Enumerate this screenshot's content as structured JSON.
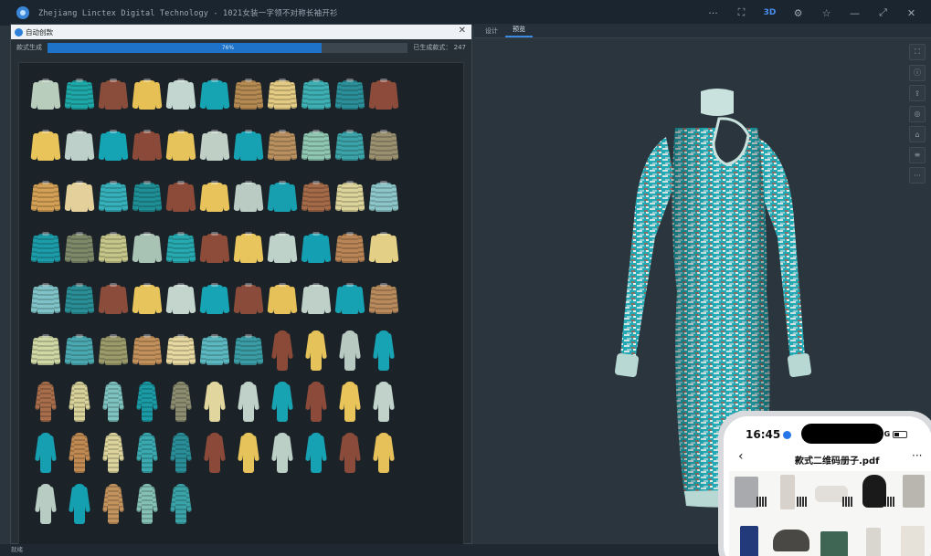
{
  "window": {
    "title": "Zhejiang Linctex Digital Technology - 1021女装一字领不对称长袖开衫",
    "toolbar_3d_label": "3D",
    "controls": [
      "···",
      "⛶",
      "3D",
      "⚙",
      "☆",
      "—",
      "⤢",
      "✕"
    ]
  },
  "dialog": {
    "title": "自动创款",
    "close_label": "✕",
    "progress_label": "款式生成",
    "progress_percent": 76,
    "progress_text": "76%",
    "generated_label": "已生成款式： 247"
  },
  "colors": {
    "accent": "#1e73c8",
    "teal": "#19a9b8",
    "yellow": "#e7c15a",
    "rust": "#8a4a3a",
    "mint": "#b7d8c8"
  },
  "gallery": {
    "items": [
      {
        "type": "sweater",
        "color": "#b9cdbd",
        "stripe": false
      },
      {
        "type": "sweater",
        "color": "#1ea7a7",
        "stripe": true
      },
      {
        "type": "sweater",
        "color": "#8a4d3c",
        "stripe": false
      },
      {
        "type": "sweater",
        "color": "#e6bf55",
        "stripe": false
      },
      {
        "type": "sweater",
        "color": "#c3d6cf",
        "stripe": false
      },
      {
        "type": "sweater",
        "color": "#16a3b2",
        "stripe": false
      },
      {
        "type": "sweater",
        "color": "#b58a52",
        "stripe": true
      },
      {
        "type": "sweater",
        "color": "#e3cb83",
        "stripe": true
      },
      {
        "type": "sweater",
        "color": "#3eb0b4",
        "stripe": true
      },
      {
        "type": "sweater",
        "color": "#2b8f99",
        "stripe": true
      },
      {
        "type": "sweater",
        "color": "#8c4b3b",
        "stripe": false
      },
      {
        "type": "sweater",
        "color": "#e9c45a",
        "stripe": false
      },
      {
        "type": "sweater",
        "color": "#bdd0c9",
        "stripe": false
      },
      {
        "type": "sweater",
        "color": "#15a4b4",
        "stripe": false
      },
      {
        "type": "sweater",
        "color": "#8b4a39",
        "stripe": false
      },
      {
        "type": "sweater",
        "color": "#e7c35b",
        "stripe": false
      },
      {
        "type": "sweater",
        "color": "#c0cfc6",
        "stripe": false
      },
      {
        "type": "sweater",
        "color": "#17a2b3",
        "stripe": false
      },
      {
        "type": "sweater",
        "color": "#b88f5e",
        "stripe": true
      },
      {
        "type": "sweater",
        "color": "#8fc7b2",
        "stripe": true
      },
      {
        "type": "sweater",
        "color": "#3aa4a8",
        "stripe": true
      },
      {
        "type": "sweater",
        "color": "#9a9070",
        "stripe": true
      },
      {
        "type": "sweater",
        "color": "#d4a055",
        "stripe": true
      },
      {
        "type": "sweater",
        "color": "#e3d09a",
        "stripe": false
      },
      {
        "type": "sweater",
        "color": "#36b0ba",
        "stripe": true
      },
      {
        "type": "sweater",
        "color": "#1f8f96",
        "stripe": true
      },
      {
        "type": "sweater",
        "color": "#8c4a38",
        "stripe": false
      },
      {
        "type": "sweater",
        "color": "#e8c35c",
        "stripe": false
      },
      {
        "type": "sweater",
        "color": "#b9cbc3",
        "stripe": false
      },
      {
        "type": "sweater",
        "color": "#179fb0",
        "stripe": false
      },
      {
        "type": "sweater",
        "color": "#a56a48",
        "stripe": true
      },
      {
        "type": "sweater",
        "color": "#dcd49a",
        "stripe": true
      },
      {
        "type": "sweater",
        "color": "#8cc6c8",
        "stripe": true
      },
      {
        "type": "sweater",
        "color": "#1c9ca8",
        "stripe": true
      },
      {
        "type": "sweater",
        "color": "#7c8a6a",
        "stripe": true
      },
      {
        "type": "sweater",
        "color": "#c7c68a",
        "stripe": true
      },
      {
        "type": "sweater",
        "color": "#a8c2b4",
        "stripe": false
      },
      {
        "type": "sweater",
        "color": "#27a9b0",
        "stripe": true
      },
      {
        "type": "sweater",
        "color": "#8d4c3a",
        "stripe": false
      },
      {
        "type": "sweater",
        "color": "#e9c55d",
        "stripe": false
      },
      {
        "type": "sweater",
        "color": "#bfd2ca",
        "stripe": false
      },
      {
        "type": "sweater",
        "color": "#14a0b2",
        "stripe": false
      },
      {
        "type": "sweater",
        "color": "#b98556",
        "stripe": true
      },
      {
        "type": "sweater",
        "color": "#e4cf86",
        "stripe": false
      },
      {
        "type": "sweater",
        "color": "#7fc3c8",
        "stripe": true
      },
      {
        "type": "sweater",
        "color": "#2a8e96",
        "stripe": true
      },
      {
        "type": "sweater",
        "color": "#8b4c3b",
        "stripe": false
      },
      {
        "type": "sweater",
        "color": "#e8c45c",
        "stripe": false
      },
      {
        "type": "sweater",
        "color": "#c3d5cd",
        "stripe": false
      },
      {
        "type": "sweater",
        "color": "#17a4b4",
        "stripe": false
      },
      {
        "type": "sweater",
        "color": "#8a4b3a",
        "stripe": false
      },
      {
        "type": "sweater",
        "color": "#e6c15a",
        "stripe": false
      },
      {
        "type": "sweater",
        "color": "#bed0c7",
        "stripe": false
      },
      {
        "type": "sweater",
        "color": "#16a2b3",
        "stripe": false
      },
      {
        "type": "sweater",
        "color": "#b88a5c",
        "stripe": true
      },
      {
        "type": "sweater",
        "color": "#cfd7a4",
        "stripe": true
      },
      {
        "type": "sweater",
        "color": "#4aa8b0",
        "stripe": true
      },
      {
        "type": "sweater",
        "color": "#9a9a6a",
        "stripe": true
      },
      {
        "type": "sweater",
        "color": "#c2905a",
        "stripe": true
      },
      {
        "type": "sweater",
        "color": "#e6d8a0",
        "stripe": true
      },
      {
        "type": "sweater",
        "color": "#5cb8c0",
        "stripe": true
      },
      {
        "type": "sweater",
        "color": "#3a9da5",
        "stripe": true
      },
      {
        "type": "dress",
        "color": "#8b4a38",
        "stripe": false
      },
      {
        "type": "dress",
        "color": "#e6c25a",
        "stripe": false
      },
      {
        "type": "dress",
        "color": "#b7c9c1",
        "stripe": false
      },
      {
        "type": "dress",
        "color": "#17a3b3",
        "stripe": false
      },
      {
        "type": "dress",
        "color": "#a86e4c",
        "stripe": true
      },
      {
        "type": "dress",
        "color": "#d8d29a",
        "stripe": true
      },
      {
        "type": "dress",
        "color": "#7fc3c0",
        "stripe": true
      },
      {
        "type": "dress",
        "color": "#1a9ba6",
        "stripe": true
      },
      {
        "type": "dress",
        "color": "#8c8c70",
        "stripe": true
      },
      {
        "type": "dress",
        "color": "#e0d69e",
        "stripe": false
      },
      {
        "type": "dress",
        "color": "#bfd1c8",
        "stripe": false
      },
      {
        "type": "dress",
        "color": "#18a3b3",
        "stripe": false
      },
      {
        "type": "dress",
        "color": "#8c4b3a",
        "stripe": false
      },
      {
        "type": "dress",
        "color": "#e8c45b",
        "stripe": false
      },
      {
        "type": "dress",
        "color": "#c0d2ca",
        "stripe": false
      },
      {
        "type": "dress",
        "color": "#169fb0",
        "stripe": false
      },
      {
        "type": "dress",
        "color": "#c08a52",
        "stripe": true
      },
      {
        "type": "dress",
        "color": "#dcd49c",
        "stripe": true
      },
      {
        "type": "dress",
        "color": "#3aa9b0",
        "stripe": true
      },
      {
        "type": "dress",
        "color": "#2a8e98",
        "stripe": true
      },
      {
        "type": "dress",
        "color": "#8b4a39",
        "stripe": false
      },
      {
        "type": "dress",
        "color": "#e7c35b",
        "stripe": false
      },
      {
        "type": "dress",
        "color": "#bccfc6",
        "stripe": false
      },
      {
        "type": "dress",
        "color": "#16a2b3",
        "stripe": false
      },
      {
        "type": "dress",
        "color": "#8a4b3a",
        "stripe": false
      },
      {
        "type": "dress",
        "color": "#e6c15a",
        "stripe": false
      },
      {
        "type": "dress",
        "color": "#b9ccc3",
        "stripe": false
      },
      {
        "type": "dress",
        "color": "#15a0b2",
        "stripe": false
      },
      {
        "type": "dress",
        "color": "#c3935e",
        "stripe": true
      },
      {
        "type": "dress",
        "color": "#84c0b6",
        "stripe": true
      },
      {
        "type": "dress",
        "color": "#3aa3a8",
        "stripe": true
      }
    ]
  },
  "viewport": {
    "tabs": [
      {
        "label": "设计",
        "active": false
      },
      {
        "label": "预览",
        "active": true
      }
    ],
    "tools": [
      "⛶",
      "ⓘ",
      "⇪",
      "◎",
      "⌂",
      "≡",
      "···"
    ]
  },
  "status": {
    "text": "就绪"
  },
  "phone": {
    "time": "16:45",
    "signal": "5G",
    "back": "‹",
    "file_name": "款式二维码册子.pdf",
    "more": "···"
  }
}
